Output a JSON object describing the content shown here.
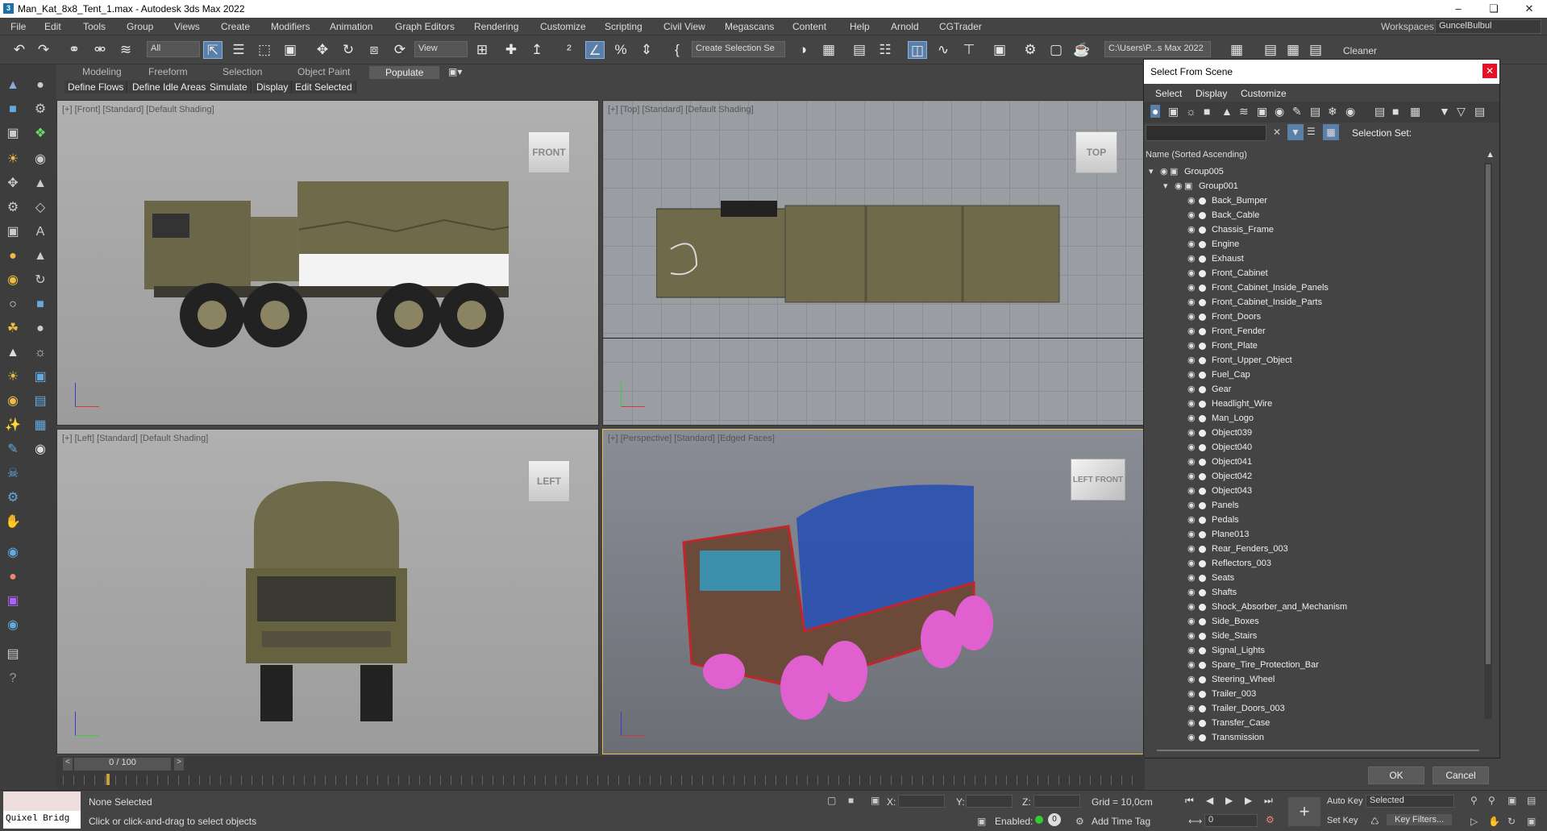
{
  "window": {
    "title": "Man_Kat_8x8_Tent_1.max - Autodesk 3ds Max 2022"
  },
  "menu": [
    "File",
    "Edit",
    "Tools",
    "Group",
    "Views",
    "Create",
    "Modifiers",
    "Animation",
    "Graph Editors",
    "Rendering",
    "Customize",
    "Scripting",
    "Civil View",
    "Megascans",
    "Content",
    "Help",
    "Arnold",
    "CGTrader"
  ],
  "workspace": {
    "label": "Workspaces:",
    "value": "GuncelBulbul"
  },
  "toolbar": {
    "filter": "All",
    "view": "View",
    "selection_set": "Create Selection Se",
    "path": "C:\\Users\\P...s Max 2022",
    "cleaner": "Cleaner"
  },
  "ribbon": {
    "tabs": [
      "Modeling",
      "Freeform",
      "Selection",
      "Object Paint",
      "Populate"
    ],
    "buttons": [
      "Define Flows",
      "Define Idle Areas",
      "Simulate",
      "Display",
      "Edit Selected"
    ]
  },
  "viewports": {
    "front": {
      "label": "[+] [Front] [Standard] [Default Shading]",
      "cube": "FRONT"
    },
    "top": {
      "label": "[+] [Top] [Standard] [Default Shading]",
      "cube": "TOP"
    },
    "left": {
      "label": "[+] [Left] [Standard] [Default Shading]",
      "cube": "LEFT"
    },
    "perspective": {
      "label": "[+] [Perspective] [Standard] [Edged Faces]",
      "cube_left": "LEFT",
      "cube_front": "FRONT"
    }
  },
  "select_from_scene": {
    "title": "Select From Scene",
    "tabs": [
      "Select",
      "Display",
      "Customize"
    ],
    "selection_set_label": "Selection Set:",
    "column_header": "Name (Sorted Ascending)",
    "groups": [
      "Group005",
      "Group001"
    ],
    "items": [
      "Back_Bumper",
      "Back_Cable",
      "Chassis_Frame",
      "Engine",
      "Exhaust",
      "Front_Cabinet",
      "Front_Cabinet_Inside_Panels",
      "Front_Cabinet_Inside_Parts",
      "Front_Doors",
      "Front_Fender",
      "Front_Plate",
      "Front_Upper_Object",
      "Fuel_Cap",
      "Gear",
      "Headlight_Wire",
      "Man_Logo",
      "Object039",
      "Object040",
      "Object041",
      "Object042",
      "Object043",
      "Panels",
      "Pedals",
      "Plane013",
      "Rear_Fenders_003",
      "Reflectors_003",
      "Seats",
      "Shafts",
      "Shock_Absorber_and_Mechanism",
      "Side_Boxes",
      "Side_Stairs",
      "Signal_Lights",
      "Spare_Tire_Protection_Bar",
      "Steering_Wheel",
      "Trailer_003",
      "Trailer_Doors_003",
      "Transfer_Case",
      "Transmission"
    ],
    "ok": "OK",
    "cancel": "Cancel"
  },
  "timeline": {
    "frame": "0 / 100"
  },
  "status": {
    "quixel": "Quixel Bridg",
    "selection": "None Selected",
    "hint": "Click or click-and-drag to select objects",
    "x_label": "X:",
    "y_label": "Y:",
    "z_label": "Z:",
    "grid": "Grid = 10,0cm",
    "enabled": "Enabled:",
    "add_time_tag": "Add Time Tag",
    "auto_key": "Auto Key",
    "selected": "Selected",
    "set_key": "Set Key",
    "key_filters": "Key Filters...",
    "frame_value": "0"
  },
  "colors": {
    "truck_olive": "#6f6a4a",
    "wire_red": "#c0262a",
    "wire_blue": "#2950b0",
    "wire_pink": "#e060d0",
    "accent": "#5a7fa8"
  }
}
